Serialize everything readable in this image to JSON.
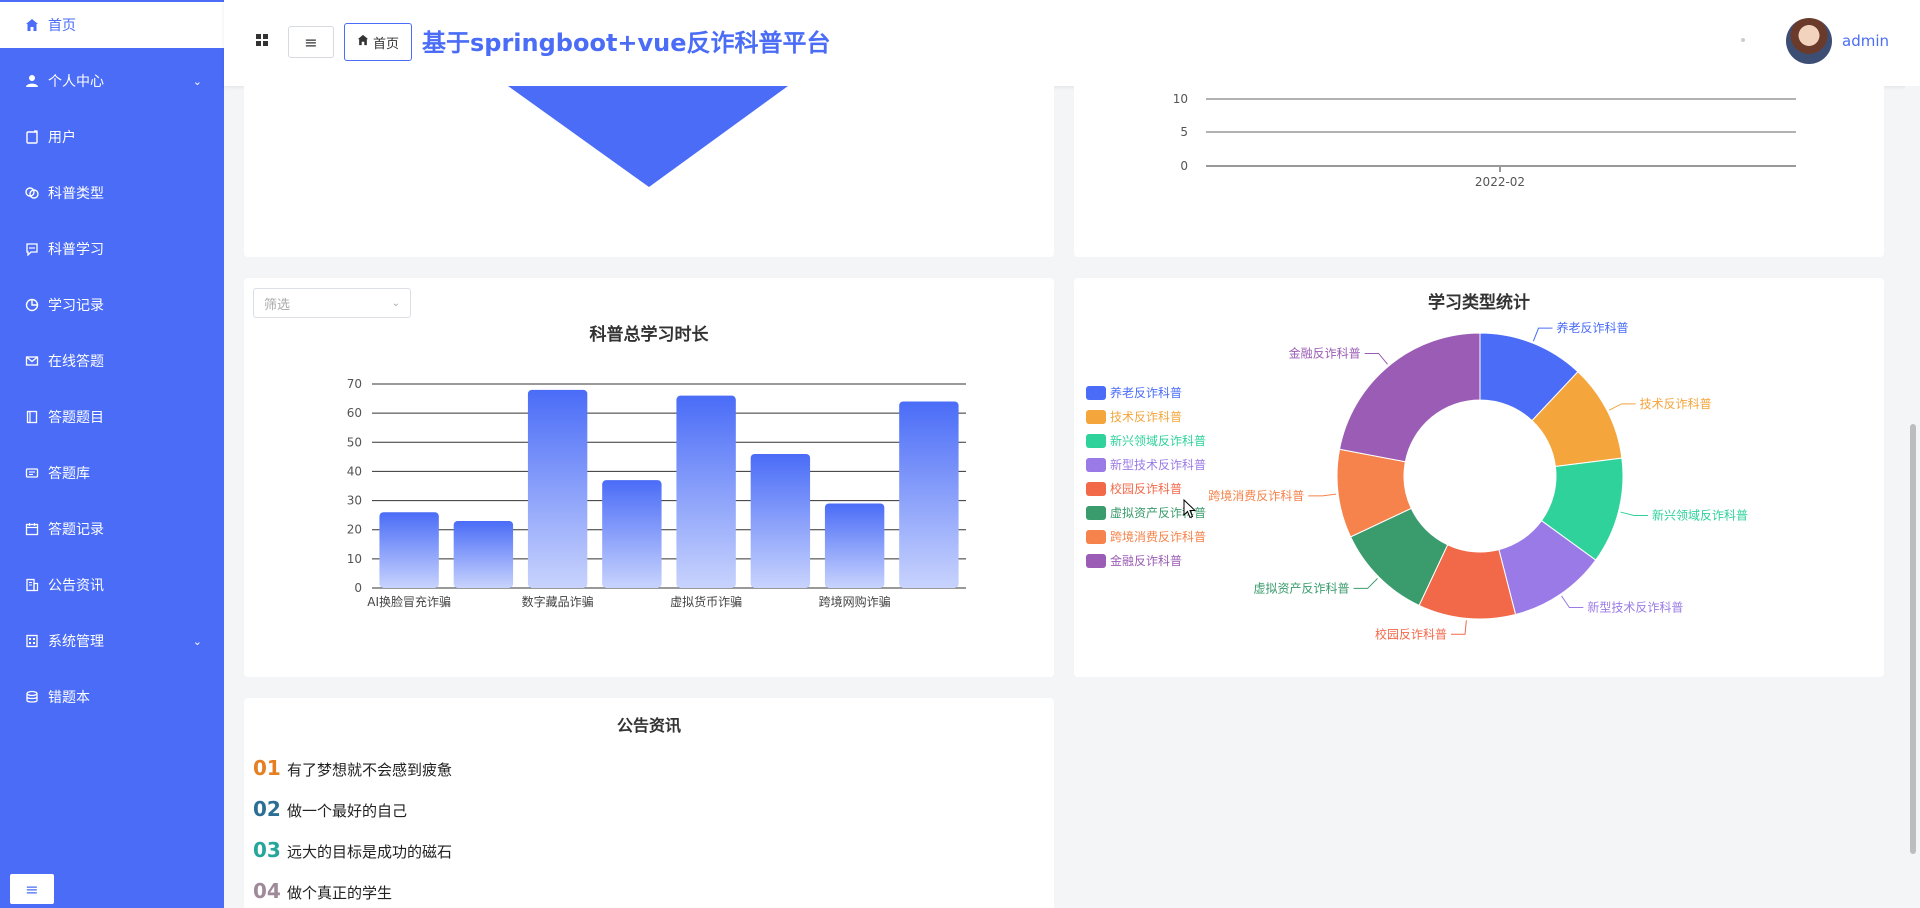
{
  "sidebar": {
    "items": [
      {
        "label": "首页",
        "icon": "home-icon"
      },
      {
        "label": "个人中心",
        "icon": "person-icon"
      },
      {
        "label": "用户",
        "icon": "user-doc-icon"
      },
      {
        "label": "科普类型",
        "icon": "category-icon"
      },
      {
        "label": "科普学习",
        "icon": "chat-icon"
      },
      {
        "label": "学习记录",
        "icon": "pie-icon"
      },
      {
        "label": "在线答题",
        "icon": "mail-icon"
      },
      {
        "label": "答题题目",
        "icon": "book-icon"
      },
      {
        "label": "答题库",
        "icon": "id-card-icon"
      },
      {
        "label": "答题记录",
        "icon": "calendar-icon"
      },
      {
        "label": "公告资讯",
        "icon": "building-icon"
      },
      {
        "label": "系统管理",
        "icon": "office-icon"
      },
      {
        "label": "错题本",
        "icon": "database-icon"
      }
    ],
    "collapse_icon": "menu-icon"
  },
  "header": {
    "breadcrumb": "首页",
    "title": "基于springboot+vue反诈科普平台",
    "username": "admin"
  },
  "colors": {
    "accent": "#4a6cf7"
  },
  "line_chart": {
    "chart_data": {
      "type": "line",
      "y_ticks": [
        "10",
        "5",
        "0"
      ],
      "x": [
        "2022-02"
      ]
    }
  },
  "bar_chart": {
    "filter_placeholder": "筛选",
    "chart_data": {
      "type": "bar",
      "title": "科普总学习时长",
      "categories": [
        "AI换脸冒充诈骗",
        "",
        "数字藏品诈骗",
        "",
        "虚拟货币诈骗",
        "",
        "跨境网购诈骗",
        ""
      ],
      "values": [
        26,
        23,
        68,
        37,
        66,
        46,
        29,
        64
      ],
      "ylim": [
        0,
        70
      ],
      "y_ticks": [
        0,
        10,
        20,
        30,
        40,
        50,
        60,
        70
      ],
      "colors": [
        "#4a6cf7",
        "#c8d3fd"
      ]
    }
  },
  "pie_chart": {
    "chart_data": {
      "type": "pie",
      "title": "学习类型统计",
      "legend_position": "left",
      "slices": [
        {
          "label": "养老反诈科普",
          "value": 12,
          "color": "#4a6cf7"
        },
        {
          "label": "技术反诈科普",
          "value": 11,
          "color": "#f4a53c"
        },
        {
          "label": "新兴领域反诈科普",
          "value": 12,
          "color": "#2ed29a"
        },
        {
          "label": "新型技术反诈科普",
          "value": 11,
          "color": "#9a7ae6"
        },
        {
          "label": "校园反诈科普",
          "value": 11,
          "color": "#f2694a"
        },
        {
          "label": "虚拟资产反诈科普",
          "value": 11,
          "color": "#3a9b6c"
        },
        {
          "label": "跨境消费反诈科普",
          "value": 10,
          "color": "#f5834b"
        },
        {
          "label": "金融反诈科普",
          "value": 22,
          "color": "#9a5cb4"
        }
      ]
    }
  },
  "announcements": {
    "title": "公告资讯",
    "items": [
      {
        "num": "01",
        "text": "有了梦想就不会感到疲惫",
        "color": "#e67e22"
      },
      {
        "num": "02",
        "text": "做一个最好的自己",
        "color": "#2c6f94"
      },
      {
        "num": "03",
        "text": "远大的目标是成功的磁石",
        "color": "#26a69a"
      },
      {
        "num": "04",
        "text": "做个真正的学生",
        "color": "#9e8a99"
      }
    ]
  }
}
